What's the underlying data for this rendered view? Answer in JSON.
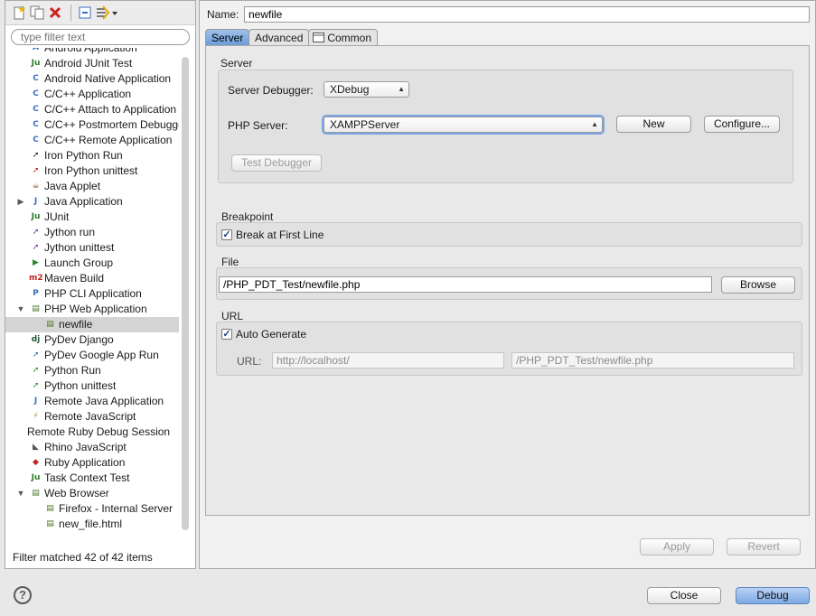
{
  "filter": {
    "placeholder": "type filter text",
    "status": "Filter matched 42 of 42 items"
  },
  "tree": [
    {
      "label": "Android Application",
      "icon": "android-app-icon",
      "glyph": "A",
      "color": "#3b6fbf",
      "depth": 0
    },
    {
      "label": "Android JUnit Test",
      "icon": "junit-icon",
      "glyph": "Ju",
      "color": "#2a7d2a",
      "depth": 0
    },
    {
      "label": "Android Native Application",
      "icon": "android-native-icon",
      "glyph": "C",
      "color": "#3b6fbf",
      "depth": 0
    },
    {
      "label": "C/C++ Application",
      "icon": "c-app-icon",
      "glyph": "C",
      "color": "#3b6fbf",
      "depth": 0
    },
    {
      "label": "C/C++ Attach to Application",
      "icon": "c-attach-icon",
      "glyph": "C",
      "color": "#3b6fbf",
      "depth": 0
    },
    {
      "label": "C/C++ Postmortem Debugger",
      "icon": "c-postmortem-icon",
      "glyph": "C",
      "color": "#3b6fbf",
      "depth": 0
    },
    {
      "label": "C/C++ Remote Application",
      "icon": "c-remote-icon",
      "glyph": "C",
      "color": "#3b6fbf",
      "depth": 0
    },
    {
      "label": "Iron Python Run",
      "icon": "python-run-icon",
      "glyph": "➚",
      "color": "#222222",
      "depth": 0
    },
    {
      "label": "Iron Python unittest",
      "icon": "python-unittest-icon",
      "glyph": "➚",
      "color": "#c02020",
      "depth": 0
    },
    {
      "label": "Java Applet",
      "icon": "java-applet-icon",
      "glyph": "☕",
      "color": "#7a4a20",
      "depth": 0
    },
    {
      "label": "Java Application",
      "icon": "java-app-icon",
      "glyph": "J",
      "color": "#3b6fbf",
      "depth": 0,
      "twisty": "▶"
    },
    {
      "label": "JUnit",
      "icon": "junit-icon",
      "glyph": "Ju",
      "color": "#2a7d2a",
      "depth": 0
    },
    {
      "label": "Jython run",
      "icon": "jython-run-icon",
      "glyph": "➚",
      "color": "#7a2a9a",
      "depth": 0
    },
    {
      "label": "Jython unittest",
      "icon": "jython-unittest-icon",
      "glyph": "➚",
      "color": "#7a2a9a",
      "depth": 0
    },
    {
      "label": "Launch Group",
      "icon": "launch-group-icon",
      "glyph": "▶",
      "color": "#2a8a2a",
      "depth": 0
    },
    {
      "label": "Maven Build",
      "icon": "maven-icon",
      "glyph": "m2",
      "color": "#c02020",
      "depth": 0
    },
    {
      "label": "PHP CLI Application",
      "icon": "php-cli-icon",
      "glyph": "P",
      "color": "#3b6fbf",
      "depth": 0
    },
    {
      "label": "PHP Web Application",
      "icon": "php-web-icon",
      "glyph": "▤",
      "color": "#4a7a2a",
      "depth": 0,
      "twisty": "▼"
    },
    {
      "label": "newfile",
      "icon": "php-config-icon",
      "glyph": "▤",
      "color": "#4a7a2a",
      "depth": 1,
      "selected": true
    },
    {
      "label": "PyDev Django",
      "icon": "django-icon",
      "glyph": "dj",
      "color": "#1e5a2e",
      "depth": 0
    },
    {
      "label": "PyDev Google App Run",
      "icon": "google-app-icon",
      "glyph": "➚",
      "color": "#2a6fbf",
      "depth": 0
    },
    {
      "label": "Python Run",
      "icon": "python-run-icon",
      "glyph": "➚",
      "color": "#2a8a2a",
      "depth": 0
    },
    {
      "label": "Python unittest",
      "icon": "python-unittest-icon",
      "glyph": "➚",
      "color": "#2a8a2a",
      "depth": 0
    },
    {
      "label": "Remote Java Application",
      "icon": "remote-java-icon",
      "glyph": "J",
      "color": "#3b6fbf",
      "depth": 0
    },
    {
      "label": "Remote JavaScript",
      "icon": "remote-js-icon",
      "glyph": "⚡",
      "color": "#b08a10",
      "depth": 0
    },
    {
      "label": "Remote Ruby Debug Session",
      "icon": "",
      "glyph": "",
      "color": "#000000",
      "depth": 0,
      "noicon": true
    },
    {
      "label": "Rhino JavaScript",
      "icon": "rhino-icon",
      "glyph": "◣",
      "color": "#555555",
      "depth": 0
    },
    {
      "label": "Ruby Application",
      "icon": "ruby-icon",
      "glyph": "◆",
      "color": "#c02020",
      "depth": 0
    },
    {
      "label": "Task Context Test",
      "icon": "junit-icon",
      "glyph": "Ju",
      "color": "#2a7d2a",
      "depth": 0
    },
    {
      "label": "Web Browser",
      "icon": "web-browser-icon",
      "glyph": "▤",
      "color": "#4a7a2a",
      "depth": 0,
      "twisty": "▼"
    },
    {
      "label": "Firefox - Internal Server",
      "icon": "browser-config-icon",
      "glyph": "▤",
      "color": "#4a7a2a",
      "depth": 1
    },
    {
      "label": "new_file.html",
      "icon": "browser-config-icon",
      "glyph": "▤",
      "color": "#4a7a2a",
      "depth": 1
    }
  ],
  "config": {
    "name_label": "Name:",
    "name_value": "newfile"
  },
  "tabs": [
    {
      "label": "Server"
    },
    {
      "label": "Advanced"
    },
    {
      "label": "Common"
    }
  ],
  "server": {
    "group_title": "Server",
    "debugger_label": "Server Debugger:",
    "debugger_value": "XDebug",
    "php_server_label": "PHP Server:",
    "php_server_value": "XAMPPServer",
    "new_button": "New",
    "configure_button": "Configure...",
    "test_debugger_button": "Test Debugger"
  },
  "breakpoint": {
    "group_title": "Breakpoint",
    "break_first_line": "Break at First Line"
  },
  "file": {
    "group_title": "File",
    "path": "/PHP_PDT_Test/newfile.php",
    "browse_button": "Browse"
  },
  "url": {
    "group_title": "URL",
    "auto_generate": "Auto Generate",
    "url_label": "URL:",
    "base_url": "http://localhost/",
    "path_url": "/PHP_PDT_Test/newfile.php"
  },
  "actions": {
    "apply": "Apply",
    "revert": "Revert",
    "close": "Close",
    "debug": "Debug"
  },
  "help": {
    "glyph": "?"
  }
}
